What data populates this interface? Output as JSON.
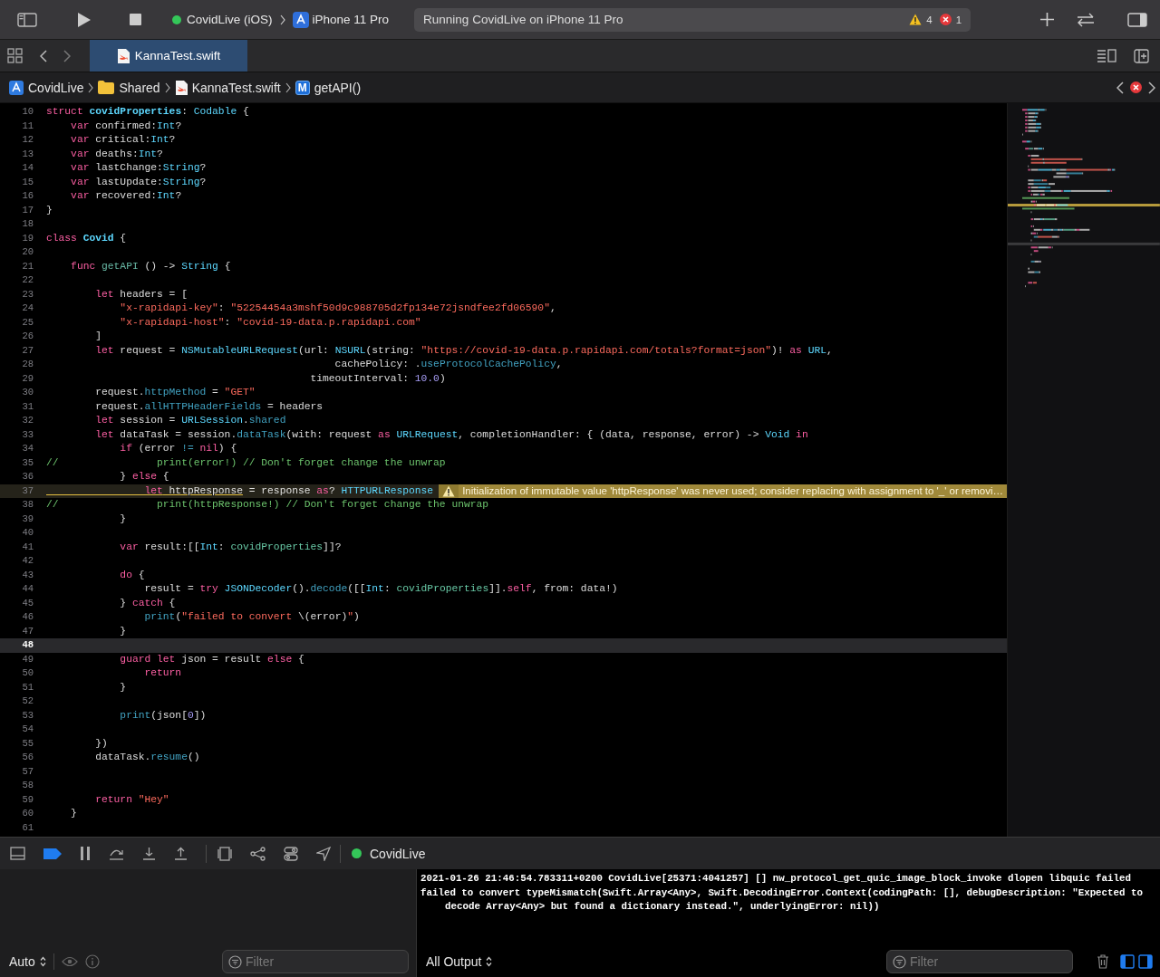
{
  "toolbar": {
    "scheme": "CovidLive (iOS)",
    "device": "iPhone 11 Pro",
    "status": "Running CovidLive on iPhone 11 Pro",
    "warnings": "4",
    "errors": "1"
  },
  "tabs": [
    {
      "label": "KannaTest.swift",
      "selected": true
    }
  ],
  "jump_bar": [
    {
      "kind": "project",
      "label": "CovidLive"
    },
    {
      "kind": "folder",
      "label": "Shared"
    },
    {
      "kind": "swift",
      "label": "KannaTest.swift"
    },
    {
      "kind": "method",
      "badge": "M",
      "label": "getAPI()"
    }
  ],
  "editor": {
    "lines": [
      {
        "number": "10",
        "current": false,
        "tokens": [
          {
            "kind": "kw",
            "text": "struct "
          },
          {
            "kind": "decl",
            "text": "covidProperties"
          },
          {
            "kind": "plain",
            "text": ": "
          },
          {
            "kind": "type",
            "text": "Codable"
          },
          {
            "kind": "plain",
            "text": " {"
          }
        ]
      },
      {
        "number": "11",
        "current": false,
        "tokens": [
          {
            "kind": "kw",
            "text": "    var"
          },
          {
            "kind": "plain",
            "text": " confirmed:"
          },
          {
            "kind": "type",
            "text": "Int"
          },
          {
            "kind": "plain",
            "text": "?"
          }
        ]
      },
      {
        "number": "12",
        "current": false,
        "tokens": [
          {
            "kind": "kw",
            "text": "    var"
          },
          {
            "kind": "plain",
            "text": " critical:"
          },
          {
            "kind": "type",
            "text": "Int"
          },
          {
            "kind": "plain",
            "text": "?"
          }
        ]
      },
      {
        "number": "13",
        "current": false,
        "tokens": [
          {
            "kind": "kw",
            "text": "    var"
          },
          {
            "kind": "plain",
            "text": " deaths:"
          },
          {
            "kind": "type",
            "text": "Int"
          },
          {
            "kind": "plain",
            "text": "?"
          }
        ]
      },
      {
        "number": "14",
        "current": false,
        "tokens": [
          {
            "kind": "kw",
            "text": "    var"
          },
          {
            "kind": "plain",
            "text": " lastChange:"
          },
          {
            "kind": "type",
            "text": "String"
          },
          {
            "kind": "plain",
            "text": "?"
          }
        ]
      },
      {
        "number": "15",
        "current": false,
        "tokens": [
          {
            "kind": "kw",
            "text": "    var"
          },
          {
            "kind": "plain",
            "text": " lastUpdate:"
          },
          {
            "kind": "type",
            "text": "String"
          },
          {
            "kind": "plain",
            "text": "?"
          }
        ]
      },
      {
        "number": "16",
        "current": false,
        "tokens": [
          {
            "kind": "kw",
            "text": "    var"
          },
          {
            "kind": "plain",
            "text": " recovered:"
          },
          {
            "kind": "type",
            "text": "Int"
          },
          {
            "kind": "plain",
            "text": "?"
          }
        ]
      },
      {
        "number": "17",
        "current": false,
        "tokens": [
          {
            "kind": "plain",
            "text": "}"
          }
        ]
      },
      {
        "number": "18",
        "current": false
      },
      {
        "number": "19",
        "current": false,
        "tokens": [
          {
            "kind": "kw",
            "text": "class "
          },
          {
            "kind": "decl",
            "text": "Covid"
          },
          {
            "kind": "plain",
            "text": " {"
          }
        ]
      },
      {
        "number": "20",
        "current": false
      },
      {
        "number": "21",
        "current": false,
        "tokens": [
          {
            "kind": "kw",
            "text": "    func "
          },
          {
            "kind": "fn",
            "text": "getAPI"
          },
          {
            "kind": "plain",
            "text": " () -> "
          },
          {
            "kind": "type",
            "text": "String"
          },
          {
            "kind": "plain",
            "text": " {"
          }
        ]
      },
      {
        "number": "22",
        "current": false
      },
      {
        "number": "23",
        "current": false,
        "tokens": [
          {
            "kind": "kw",
            "text": "        let"
          },
          {
            "kind": "plain",
            "text": " headers = ["
          }
        ]
      },
      {
        "number": "24",
        "current": false,
        "tokens": [
          {
            "kind": "str",
            "text": "            \"x-rapidapi-key\""
          },
          {
            "kind": "plain",
            "text": ": "
          },
          {
            "kind": "str",
            "text": "\"52254454a3mshf50d9c988705d2fp134e72jsndfee2fd06590\""
          },
          {
            "kind": "plain",
            "text": ","
          }
        ]
      },
      {
        "number": "25",
        "current": false,
        "tokens": [
          {
            "kind": "str",
            "text": "            \"x-rapidapi-host\""
          },
          {
            "kind": "plain",
            "text": ": "
          },
          {
            "kind": "str",
            "text": "\"covid-19-data.p.rapidapi.com\""
          }
        ]
      },
      {
        "number": "26",
        "current": false,
        "tokens": [
          {
            "kind": "plain",
            "text": "        ]"
          }
        ]
      },
      {
        "number": "27",
        "current": false,
        "tokens": [
          {
            "kind": "kw",
            "text": "        let"
          },
          {
            "kind": "plain",
            "text": " request = "
          },
          {
            "kind": "type",
            "text": "NSMutableURLRequest"
          },
          {
            "kind": "plain",
            "text": "(url: "
          },
          {
            "kind": "type",
            "text": "NSURL"
          },
          {
            "kind": "plain",
            "text": "(string: "
          },
          {
            "kind": "str",
            "text": "\"https://covid-19-data.p.rapidapi.com/totals?format=json\""
          },
          {
            "kind": "plain",
            "text": ")! "
          },
          {
            "kind": "kw",
            "text": "as"
          },
          {
            "kind": "type",
            "text": " URL"
          },
          {
            "kind": "plain",
            "text": ","
          }
        ]
      },
      {
        "number": "28",
        "current": false,
        "tokens": [
          {
            "kind": "plain",
            "text": "                                               cachePolicy: ."
          },
          {
            "kind": "member",
            "text": "useProtocolCachePolicy"
          },
          {
            "kind": "plain",
            "text": ","
          }
        ]
      },
      {
        "number": "29",
        "current": false,
        "tokens": [
          {
            "kind": "plain",
            "text": "                                           timeoutInterval: "
          },
          {
            "kind": "num",
            "text": "10.0"
          },
          {
            "kind": "plain",
            "text": ")"
          }
        ]
      },
      {
        "number": "30",
        "current": false,
        "tokens": [
          {
            "kind": "plain",
            "text": "        request."
          },
          {
            "kind": "member",
            "text": "httpMethod"
          },
          {
            "kind": "plain",
            "text": " = "
          },
          {
            "kind": "str",
            "text": "\"GET\""
          }
        ]
      },
      {
        "number": "31",
        "current": false,
        "tokens": [
          {
            "kind": "plain",
            "text": "        request."
          },
          {
            "kind": "member",
            "text": "allHTTPHeaderFields"
          },
          {
            "kind": "plain",
            "text": " = headers"
          }
        ]
      },
      {
        "number": "32",
        "current": false,
        "tokens": [
          {
            "kind": "kw",
            "text": "        let"
          },
          {
            "kind": "plain",
            "text": " session = "
          },
          {
            "kind": "type",
            "text": "URLSession"
          },
          {
            "kind": "plain",
            "text": "."
          },
          {
            "kind": "member",
            "text": "shared"
          }
        ]
      },
      {
        "number": "33",
        "current": false,
        "tokens": [
          {
            "kind": "kw",
            "text": "        let"
          },
          {
            "kind": "plain",
            "text": " dataTask = session."
          },
          {
            "kind": "member",
            "text": "dataTask"
          },
          {
            "kind": "plain",
            "text": "(with: request "
          },
          {
            "kind": "kw",
            "text": "as"
          },
          {
            "kind": "type",
            "text": " URLRequest"
          },
          {
            "kind": "plain",
            "text": ", completionHandler: { (data, response, error) -> "
          },
          {
            "kind": "type",
            "text": "Void"
          },
          {
            "kind": "kw",
            "text": " in"
          }
        ]
      },
      {
        "number": "34",
        "current": false,
        "tokens": [
          {
            "kind": "kw",
            "text": "            if"
          },
          {
            "kind": "plain",
            "text": " (error "
          },
          {
            "kind": "member",
            "text": "!="
          },
          {
            "kind": "kw",
            "text": " nil"
          },
          {
            "kind": "plain",
            "text": ") {"
          }
        ]
      },
      {
        "number": "35",
        "current": false,
        "tokens": [
          {
            "kind": "com",
            "text": "//                print(error!) // Don't forget change the unwrap"
          }
        ]
      },
      {
        "number": "36",
        "current": false,
        "tokens": [
          {
            "kind": "plain",
            "text": "            } "
          },
          {
            "kind": "kw",
            "text": "else"
          },
          {
            "kind": "plain",
            "text": " {"
          }
        ]
      },
      {
        "number": "37",
        "current": false,
        "tokens": [
          {
            "kind": "warn_kw",
            "text": "                let"
          },
          {
            "kind": "warn_plain",
            "text": " httpResponse"
          },
          {
            "kind": "plain",
            "text": " = response "
          },
          {
            "kind": "kw",
            "text": "as"
          },
          {
            "kind": "plain",
            "text": "? "
          },
          {
            "kind": "type",
            "text": "HTTPURLResponse"
          }
        ],
        "issue": {
          "kind": "warning",
          "message": "Initialization of immutable value 'httpResponse' was never used; consider replacing with assignment to '_' or removi…"
        }
      },
      {
        "number": "38",
        "current": false,
        "tokens": [
          {
            "kind": "com",
            "text": "//                print(httpResponse!) // Don't forget change the unwrap"
          }
        ]
      },
      {
        "number": "39",
        "current": false,
        "tokens": [
          {
            "kind": "plain",
            "text": "            }"
          }
        ]
      },
      {
        "number": "40",
        "current": false
      },
      {
        "number": "41",
        "current": false,
        "tokens": [
          {
            "kind": "kw",
            "text": "            var"
          },
          {
            "kind": "plain",
            "text": " result:[["
          },
          {
            "kind": "type",
            "text": "Int"
          },
          {
            "kind": "plain",
            "text": ": "
          },
          {
            "kind": "proj",
            "text": "covidProperties"
          },
          {
            "kind": "plain",
            "text": "]]?"
          }
        ]
      },
      {
        "number": "42",
        "current": false
      },
      {
        "number": "43",
        "current": false,
        "tokens": [
          {
            "kind": "kw",
            "text": "            do"
          },
          {
            "kind": "plain",
            "text": " {"
          }
        ]
      },
      {
        "number": "44",
        "current": false,
        "tokens": [
          {
            "kind": "plain",
            "text": "                result = "
          },
          {
            "kind": "kw",
            "text": "try"
          },
          {
            "kind": "type",
            "text": " JSONDecoder"
          },
          {
            "kind": "plain",
            "text": "()."
          },
          {
            "kind": "member",
            "text": "decode"
          },
          {
            "kind": "plain",
            "text": "([["
          },
          {
            "kind": "type",
            "text": "Int"
          },
          {
            "kind": "plain",
            "text": ": "
          },
          {
            "kind": "proj",
            "text": "covidProperties"
          },
          {
            "kind": "plain",
            "text": "]]."
          },
          {
            "kind": "kw",
            "text": "self"
          },
          {
            "kind": "plain",
            "text": ", from: data!)"
          }
        ]
      },
      {
        "number": "45",
        "current": false,
        "tokens": [
          {
            "kind": "plain",
            "text": "            } "
          },
          {
            "kind": "kw",
            "text": "catch"
          },
          {
            "kind": "plain",
            "text": " {"
          }
        ]
      },
      {
        "number": "46",
        "current": false,
        "tokens": [
          {
            "kind": "member",
            "text": "                print"
          },
          {
            "kind": "plain",
            "text": "("
          },
          {
            "kind": "str",
            "text": "\"failed to convert "
          },
          {
            "kind": "plain",
            "text": "\\(error)"
          },
          {
            "kind": "str",
            "text": "\""
          },
          {
            "kind": "plain",
            "text": ")"
          }
        ]
      },
      {
        "number": "47",
        "current": false,
        "tokens": [
          {
            "kind": "plain",
            "text": "            }"
          }
        ]
      },
      {
        "number": "48",
        "current": true
      },
      {
        "number": "49",
        "current": false,
        "tokens": [
          {
            "kind": "kw",
            "text": "            guard let"
          },
          {
            "kind": "plain",
            "text": " json = result "
          },
          {
            "kind": "kw",
            "text": "else"
          },
          {
            "kind": "plain",
            "text": " {"
          }
        ]
      },
      {
        "number": "50",
        "current": false,
        "tokens": [
          {
            "kind": "kw",
            "text": "                return"
          }
        ]
      },
      {
        "number": "51",
        "current": false,
        "tokens": [
          {
            "kind": "plain",
            "text": "            }"
          }
        ]
      },
      {
        "number": "52",
        "current": false
      },
      {
        "number": "53",
        "current": false,
        "tokens": [
          {
            "kind": "member",
            "text": "            print"
          },
          {
            "kind": "plain",
            "text": "(json["
          },
          {
            "kind": "num",
            "text": "0"
          },
          {
            "kind": "plain",
            "text": "])"
          }
        ]
      },
      {
        "number": "54",
        "current": false
      },
      {
        "number": "55",
        "current": false,
        "tokens": [
          {
            "kind": "plain",
            "text": "        })"
          }
        ]
      },
      {
        "number": "56",
        "current": false,
        "tokens": [
          {
            "kind": "plain",
            "text": "        dataTask."
          },
          {
            "kind": "member",
            "text": "resume"
          },
          {
            "kind": "plain",
            "text": "()"
          }
        ]
      },
      {
        "number": "57",
        "current": false
      },
      {
        "number": "58",
        "current": false
      },
      {
        "number": "59",
        "current": false,
        "tokens": [
          {
            "kind": "kw",
            "text": "        return"
          },
          {
            "kind": "str",
            "text": " \"Hey\""
          }
        ]
      },
      {
        "number": "60",
        "current": false,
        "tokens": [
          {
            "kind": "plain",
            "text": "    }"
          }
        ]
      },
      {
        "number": "61",
        "current": false
      }
    ]
  },
  "debug_bar": {
    "breakpoints_active": true,
    "process": "CovidLive"
  },
  "console": {
    "scope": "Auto",
    "variables_filter": {
      "placeholder": "Filter"
    },
    "output_mode": "All Output",
    "output_filter": {
      "placeholder": "Filter"
    },
    "show_variables": true,
    "show_console": true,
    "output": [
      "2021-01-26 21:46:54.783311+0200 CovidLive[25371:4041257] [] nw_protocol_get_quic_image_block_invoke dlopen libquic failed",
      "failed to convert typeMismatch(Swift.Array<Any>, Swift.DecodingError.Context(codingPath: [], debugDescription: \"Expected to decode Array<Any> but found a dictionary instead.\", underlyingError: nil))"
    ]
  }
}
